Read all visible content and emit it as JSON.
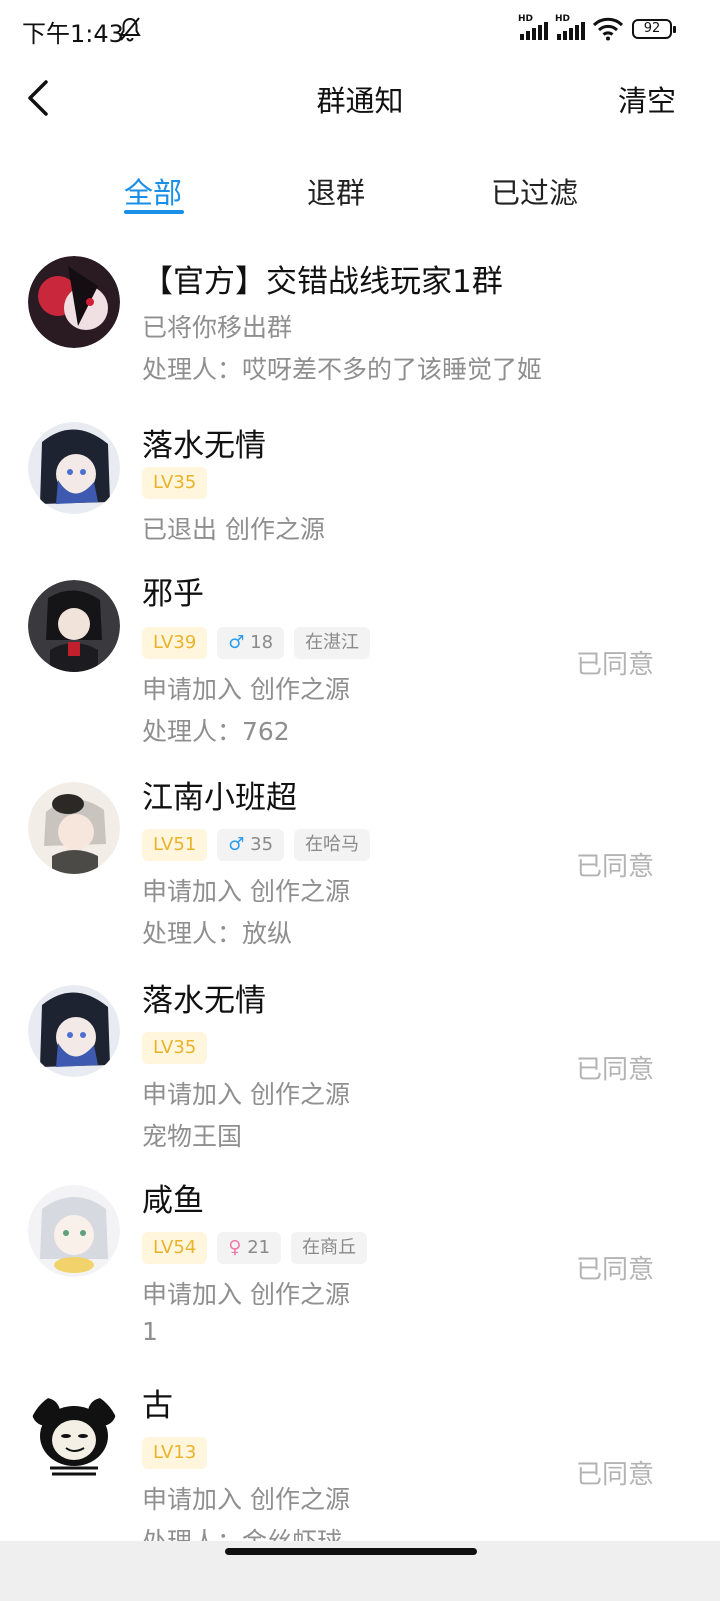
{
  "status": {
    "time": "下午1:43",
    "hd_label": "HD",
    "battery": "92",
    "icons": [
      "bell-off-icon",
      "signal-hd-icon",
      "signal-hd-icon",
      "wifi-icon",
      "battery-icon"
    ]
  },
  "header": {
    "title": "群通知",
    "clear_label": "清空",
    "back_icon": "chevron-left-icon"
  },
  "tabs": [
    {
      "label": "全部",
      "active": true
    },
    {
      "label": "退群",
      "active": false
    },
    {
      "label": "已过滤",
      "active": false
    }
  ],
  "colors": {
    "accent": "#1a8fe8",
    "level_badge_text": "#e9b32b",
    "level_badge_bg": "#fff6dd",
    "secondary_text": "#8f8f8f",
    "action_text": "#b3b3b3"
  },
  "notifications": [
    {
      "name": "【官方】交错战线玩家1群",
      "line1": "已将你移出群",
      "line2": "处理人：哎呀差不多的了该睡觉了姬"
    },
    {
      "name": "落水无情",
      "level": "LV35",
      "line1": "已退出 创作之源"
    },
    {
      "name": "邪乎",
      "level": "LV39",
      "gender": "♂",
      "age": "18",
      "location": "在湛江",
      "line1": "申请加入 创作之源",
      "line2": "处理人：762",
      "status": "已同意"
    },
    {
      "name": "江南小班超",
      "level": "LV51",
      "gender": "♂",
      "age": "35",
      "location": "在哈马",
      "line1": "申请加入 创作之源",
      "line2": "处理人：放纵",
      "status": "已同意"
    },
    {
      "name": "落水无情",
      "level": "LV35",
      "line1": "申请加入 创作之源",
      "line2": "宠物王国",
      "status": "已同意"
    },
    {
      "name": "咸鱼",
      "level": "LV54",
      "gender": "♀",
      "age": "21",
      "location": "在商丘",
      "line1": "申请加入 创作之源",
      "line2": "1",
      "status": "已同意"
    },
    {
      "name": "古",
      "level": "LV13",
      "line1": "申请加入 创作之源",
      "line2": "处理人：金丝虾球",
      "status": "已同意"
    }
  ]
}
